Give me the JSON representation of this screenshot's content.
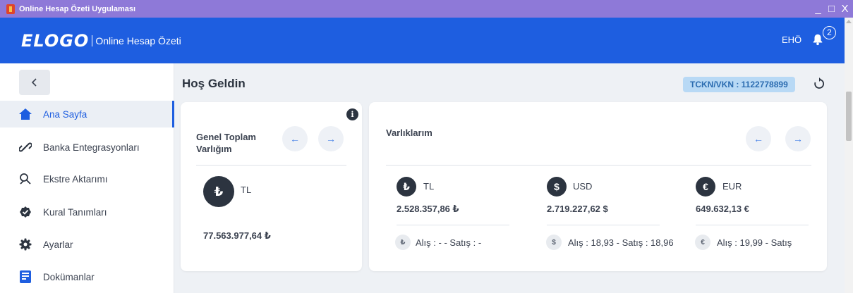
{
  "window": {
    "title": "Online Hesap Özeti Uygulaması",
    "controls": [
      "_",
      "□",
      "X"
    ]
  },
  "header": {
    "logo": "ELOGO",
    "app_name": "Online Hesap Özeti",
    "user_initials": "EHÖ",
    "notification_count": "2"
  },
  "sidebar": {
    "items": [
      {
        "label": "Ana Sayfa",
        "icon": "home-icon",
        "active": true
      },
      {
        "label": "Banka Entegrasyonları",
        "icon": "link-icon"
      },
      {
        "label": "Ekstre Aktarımı",
        "icon": "transfer-icon"
      },
      {
        "label": "Kural Tanımları",
        "icon": "badge-check-icon"
      },
      {
        "label": "Ayarlar",
        "icon": "gear-icon"
      },
      {
        "label": "Dokümanlar",
        "icon": "document-icon"
      }
    ]
  },
  "main": {
    "greeting": "Hoş Geldin",
    "tckn": "TCKN/VKN : 1122778899",
    "total_card": {
      "title_line1": "Genel Toplam",
      "title_line2": "Varlığım",
      "currency_symbol": "₺",
      "currency": "TL",
      "amount": "77.563.977,64 ₺"
    },
    "assets_card": {
      "title": "Varlıklarım",
      "assets": [
        {
          "symbol": "₺",
          "currency": "TL",
          "amount": "2.528.357,86 ₺",
          "rate": "Alış : - - Satış : -"
        },
        {
          "symbol": "$",
          "currency": "USD",
          "amount": "2.719.227,62 $",
          "rate": "Alış : 18,93 - Satış : 18,96"
        },
        {
          "symbol": "€",
          "currency": "EUR",
          "amount": "649.632,13 €",
          "rate": "Alış : 19,99 - Satış"
        }
      ]
    },
    "arrows": {
      "prev": "←",
      "next": "→"
    },
    "info": "i"
  },
  "colors": {
    "primary": "#1e5ee0",
    "titlebar": "#8e79d8",
    "dark": "#2c3440",
    "badge_bg": "#b8d9f5"
  }
}
